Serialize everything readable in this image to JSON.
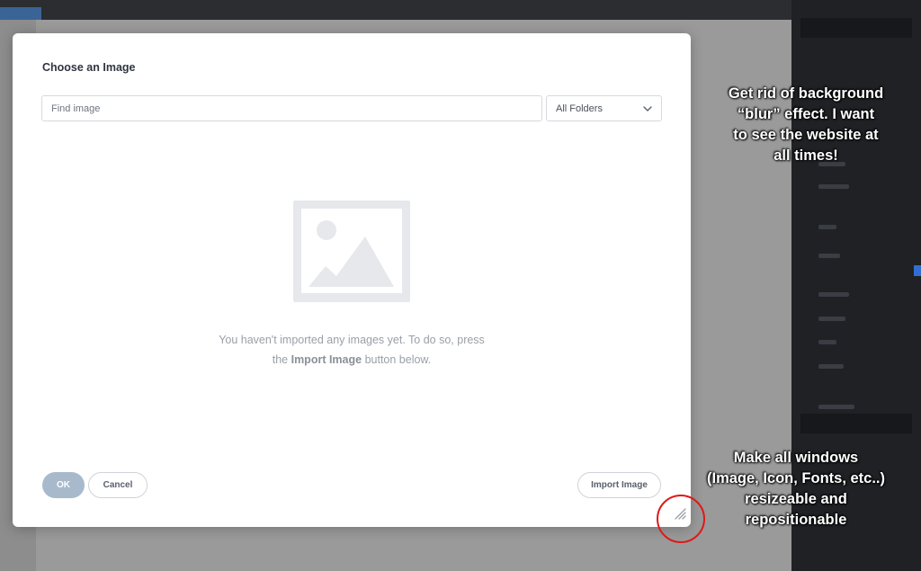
{
  "dialog": {
    "title": "Choose an Image",
    "search_placeholder": "Find image",
    "folder_select": {
      "selected": "All Folders"
    },
    "empty_message": {
      "line1": "You haven't imported any images yet. To do so, press",
      "line2_before": "the ",
      "line2_bold": "Import Image",
      "line2_after": " button below."
    },
    "buttons": {
      "ok": "OK",
      "cancel": "Cancel",
      "import": "Import Image"
    }
  },
  "annotations": {
    "note_blur": [
      "Get rid of background",
      "“blur” effect. I want",
      "to see the website at",
      "all times!"
    ],
    "note_resize": [
      "Make all windows",
      "(Image, Icon, Fonts, etc..)",
      "resizeable and",
      "repositionable"
    ],
    "circle_color": "#e01818"
  },
  "colors": {
    "ok_button": "#a9b9cc",
    "title_text": "#2f3540",
    "muted_text": "#9aa0a8"
  },
  "icons": {
    "placeholder": "image-placeholder-icon",
    "chevron": "chevron-down-icon",
    "resize": "resize-handle-icon"
  }
}
